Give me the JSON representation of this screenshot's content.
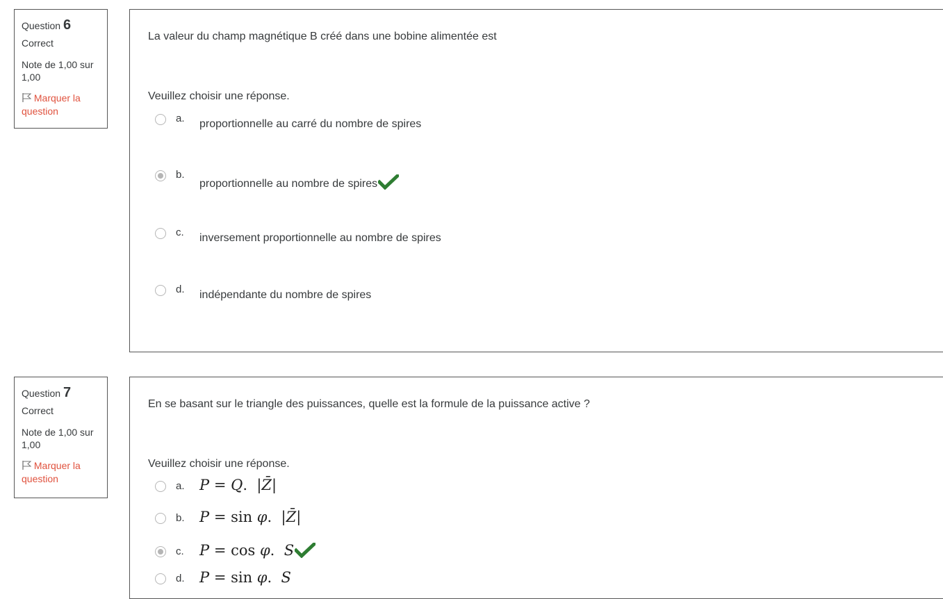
{
  "questions": [
    {
      "label": "Question",
      "number": "6",
      "state": "Correct",
      "grade": "Note de 1,00 sur 1,00",
      "flag_label": "Marquer la question",
      "text": "La valeur du champ magnétique B créé dans une bobine alimentée est",
      "prompt": "Veuillez choisir une réponse.",
      "answers": [
        {
          "letter": "a.",
          "text": "proportionnelle au carré du nombre de spires",
          "selected": false,
          "correct_mark": false
        },
        {
          "letter": "b.",
          "text": "proportionnelle au nombre de spires",
          "selected": true,
          "correct_mark": true
        },
        {
          "letter": "c.",
          "text": "inversement proportionnelle au nombre de spires",
          "selected": false,
          "correct_mark": false
        },
        {
          "letter": "d.",
          "text": "indépendante du nombre de spires",
          "selected": false,
          "correct_mark": false
        }
      ]
    },
    {
      "label": "Question",
      "number": "7",
      "state": "Correct",
      "grade": "Note de 1,00 sur 1,00",
      "flag_label": "Marquer la question",
      "text": "En se basant sur le triangle des puissances, quelle est la formule de la puissance active ?",
      "prompt": "Veuillez choisir une réponse.",
      "answers": [
        {
          "letter": "a.",
          "formula": "P = Q. |Z̄|",
          "selected": false,
          "correct_mark": false
        },
        {
          "letter": "b.",
          "formula": "P = sin φ. |Z̄|",
          "selected": false,
          "correct_mark": false
        },
        {
          "letter": "c.",
          "formula": "P = cos φ. S",
          "selected": true,
          "correct_mark": true
        },
        {
          "letter": "d.",
          "formula": "P = sin φ. S",
          "selected": false,
          "correct_mark": false
        }
      ]
    }
  ],
  "colors": {
    "flag": "#e0523e",
    "check": "#2e7d32",
    "border": "#555555",
    "radio": "#b5b5b5"
  },
  "icons": {
    "flag": "flag-icon",
    "correct": "check-icon"
  }
}
